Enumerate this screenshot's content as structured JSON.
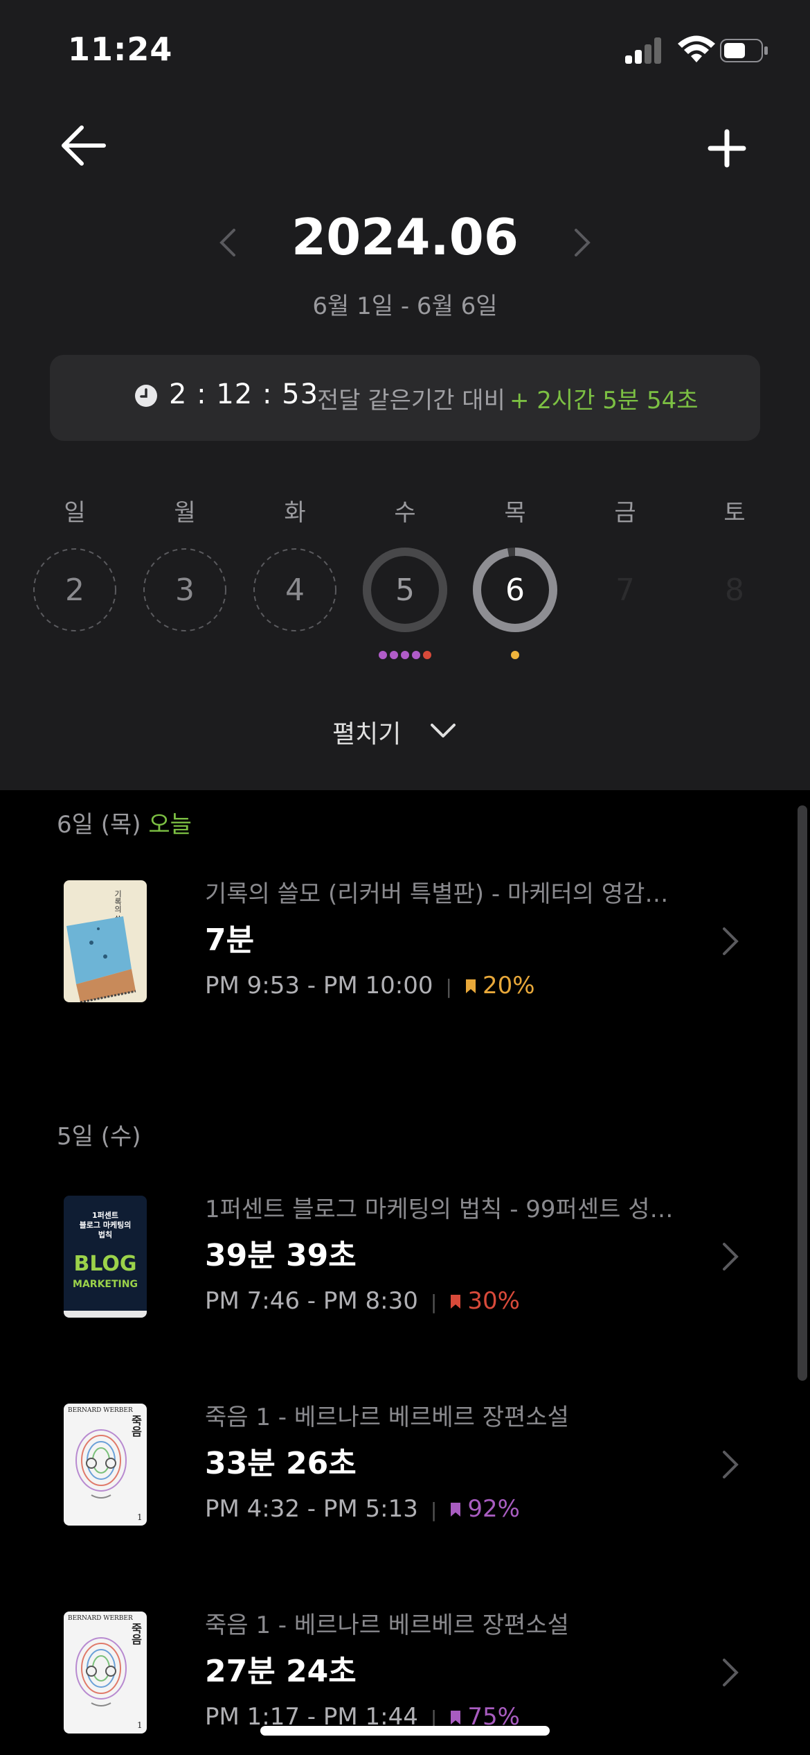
{
  "status_bar": {
    "time": "11:24"
  },
  "header": {
    "month": "2024.06",
    "range": "6월 1일 - 6월 6일"
  },
  "summary": {
    "total_time": "2 : 12 : 53",
    "compare_label": "전달 같은기간 대비",
    "diff": "+ 2시간 5분 54초",
    "accent_color": "#7cc043"
  },
  "week": {
    "weekdays": [
      "일",
      "월",
      "화",
      "수",
      "목",
      "금",
      "토"
    ],
    "days": [
      {
        "num": "2",
        "state": "empty",
        "progress": 0
      },
      {
        "num": "3",
        "state": "empty",
        "progress": 0
      },
      {
        "num": "4",
        "state": "empty",
        "progress": 0
      },
      {
        "num": "5",
        "state": "past",
        "progress": 1.0,
        "dot_colors": [
          "#b05cc8",
          "#b05cc8",
          "#b05cc8",
          "#b05cc8",
          "#d84a3a"
        ]
      },
      {
        "num": "6",
        "state": "today",
        "progress": 0.97,
        "dot_colors": [
          "#f0b43c"
        ]
      },
      {
        "num": "7",
        "state": "future",
        "progress": 0
      },
      {
        "num": "8",
        "state": "future",
        "progress": 0
      }
    ],
    "expand_label": "펼치기"
  },
  "sessions": {
    "groups": [
      {
        "date": "6일 (목)",
        "today_label": "오늘",
        "items": [
          {
            "title": "기록의 쓸모 (리커버 특별판) - 마케터의 영감…",
            "duration": "7분",
            "time_range": "PM 9:53 - PM 10:00",
            "progress": "20%",
            "color": "#e8a83a",
            "cover": "notebook"
          }
        ]
      },
      {
        "date": "5일 (수)",
        "today_label": "",
        "items": [
          {
            "title": "1퍼센트 블로그 마케팅의 법칙 - 99퍼센트 성…",
            "duration": "39분 39초",
            "time_range": "PM 7:46 - PM 8:30",
            "progress": "30%",
            "color": "#d84a3a",
            "cover": "blog"
          },
          {
            "title": "죽음 1 - 베르나르 베르베르 장편소설",
            "duration": "33분 26초",
            "time_range": "PM 4:32 - PM 5:13",
            "progress": "92%",
            "color": "#a85cc0",
            "cover": "skull"
          },
          {
            "title": "죽음 1 - 베르나르 베르베르 장편소설",
            "duration": "27분 24초",
            "time_range": "PM 1:17 - PM 1:44",
            "progress": "75%",
            "color": "#a85cc0",
            "cover": "skull"
          }
        ]
      }
    ]
  },
  "covers": {
    "notebook_title": "기록의 쓸모",
    "blog_top": "1퍼센트 블로그 마케팅의 법칙",
    "blog_main": "BLOG",
    "blog_sub": "MARKETING",
    "skull_author": "BERNARD WERBER",
    "skull_title": "죽음"
  }
}
